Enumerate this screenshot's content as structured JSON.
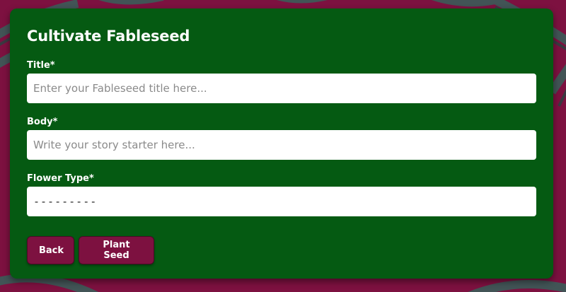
{
  "theme": {
    "page_background": "#7d1140",
    "card_background": "#055a12",
    "button_background": "#7d1140",
    "pattern_color": "#2f6b5e"
  },
  "form": {
    "title": "Cultivate Fableseed",
    "fields": {
      "title": {
        "label": "Title*",
        "placeholder": "Enter your Fableseed title here..."
      },
      "body": {
        "label": "Body*",
        "placeholder": "Write your story starter here..."
      },
      "flower_type": {
        "label": "Flower Type*",
        "selected": "---------"
      }
    },
    "buttons": {
      "back": "Back",
      "plant_seed": "Plant Seed"
    }
  }
}
